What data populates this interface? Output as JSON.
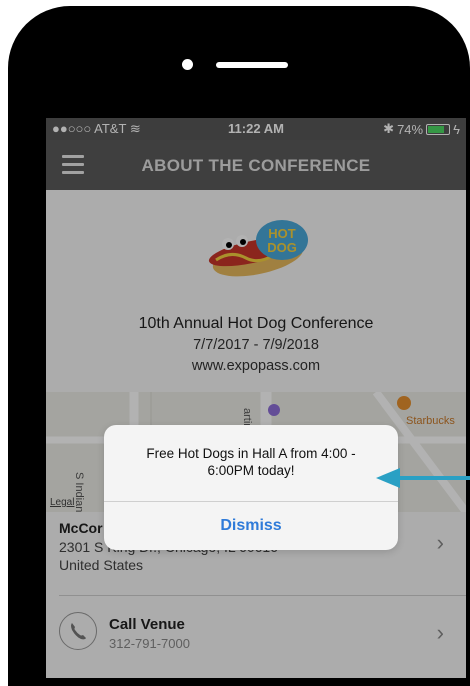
{
  "status_bar": {
    "carrier": "●●○○○ AT&T",
    "time": "11:22 AM",
    "battery": "74%",
    "battery_level": 0.74
  },
  "nav": {
    "title": "ABOUT THE CONFERENCE",
    "menu_icon": "hamburger-menu-icon"
  },
  "logo": {
    "line1": "HOT",
    "line2": "DOG"
  },
  "conference": {
    "name": "10th Annual Hot Dog Conference",
    "dates": "7/7/2017 - 7/9/2018",
    "website": "www.expopass.com"
  },
  "map": {
    "street_left": "S Indiana",
    "street_top": "artin",
    "poi": "Starbucks",
    "legal": "Legal"
  },
  "venue": {
    "name": "McCor",
    "address_line1": "2301 S King Dr., Chicago, IL 60616",
    "address_line2": "United States"
  },
  "call": {
    "label": "Call Venue",
    "number": "312-791-7000"
  },
  "alert": {
    "message": "Free Hot Dogs in Hall A from 4:00 - 6:00PM today!",
    "button": "Dismiss"
  },
  "colors": {
    "nav_bg": "#5b5b5b",
    "alert_button": "#2f7bd9",
    "arrow": "#2aa0c4"
  }
}
